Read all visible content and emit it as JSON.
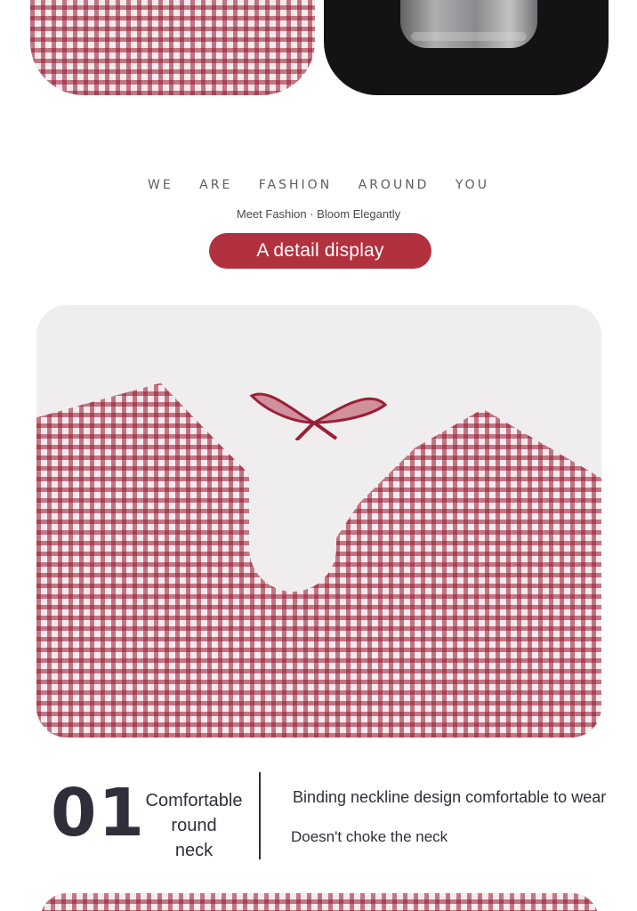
{
  "header": {
    "tagline": "WE ARE FASHION AROUND YOU",
    "subtagline": "Meet Fashion · Bloom Elegantly",
    "section_button": "A detail display"
  },
  "feature": {
    "number": "01",
    "title_lines": [
      "Comfortable",
      "round",
      "neck"
    ],
    "description_1": "Binding neckline design comfortable to wear",
    "description_2": "Doesn't choke the neck"
  },
  "colors": {
    "accent": "#b2313f",
    "text_dark": "#2e2f3b",
    "gingham_red": "#96162c"
  }
}
